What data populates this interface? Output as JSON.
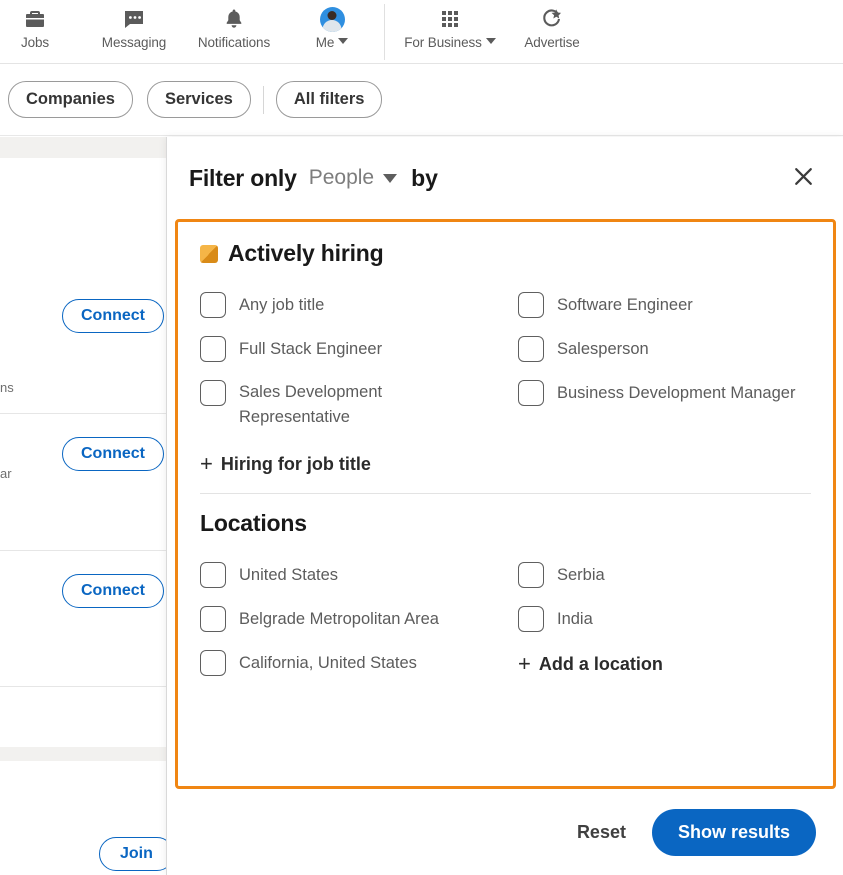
{
  "topnav": {
    "items": [
      {
        "label": "Jobs",
        "icon": "briefcase-icon"
      },
      {
        "label": "Messaging",
        "icon": "message-bubble-icon"
      },
      {
        "label": "Notifications",
        "icon": "bell-icon"
      },
      {
        "label": "Me",
        "icon": "avatar-icon"
      },
      {
        "label": "For Business",
        "icon": "grid-apps-icon"
      },
      {
        "label": "Advertise",
        "icon": "advertise-icon"
      }
    ]
  },
  "filterbar": {
    "pills": [
      {
        "label": "Companies"
      },
      {
        "label": "Services"
      },
      {
        "label": "All filters"
      }
    ]
  },
  "background": {
    "connect_label": "Connect",
    "join_label": "Join",
    "fragments": [
      "ns",
      "ar"
    ]
  },
  "modal": {
    "title_prefix": "Filter only",
    "entity_selected": "People",
    "title_suffix": "by",
    "close_icon": "close-icon",
    "sections": [
      {
        "id": "actively-hiring",
        "title": "Actively hiring",
        "badge_icon": "hiring-badge-icon",
        "badge_color": "#f5b547",
        "options": [
          {
            "label": "Any job title",
            "checked": false
          },
          {
            "label": "Software Engineer",
            "checked": false
          },
          {
            "label": "Full Stack Engineer",
            "checked": false
          },
          {
            "label": "Salesperson",
            "checked": false
          },
          {
            "label": "Sales Development Representative",
            "checked": false
          },
          {
            "label": "Business Development Manager",
            "checked": false
          }
        ],
        "add_link": "Hiring for job title"
      },
      {
        "id": "locations",
        "title": "Locations",
        "options": [
          {
            "label": "United States",
            "checked": false
          },
          {
            "label": "Serbia",
            "checked": false
          },
          {
            "label": "Belgrade Metropolitan Area",
            "checked": false
          },
          {
            "label": "India",
            "checked": false
          },
          {
            "label": "California, United States",
            "checked": false
          }
        ],
        "add_link": "Add a location"
      }
    ],
    "footer": {
      "reset_label": "Reset",
      "show_results_label": "Show results",
      "primary_color": "#0a66c2"
    },
    "highlight_color": "#f08613"
  }
}
